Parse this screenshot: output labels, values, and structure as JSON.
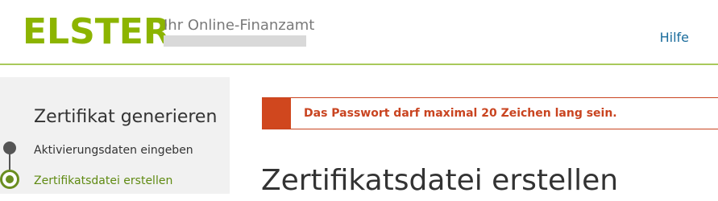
{
  "header": {
    "logo_text": "ELSTER",
    "tagline": "Ihr Online-Finanzamt",
    "help_label": "Hilfe"
  },
  "sidebar": {
    "title": "Zertifikat generieren",
    "steps": [
      {
        "label": "Aktivierungsdaten eingeben",
        "state": "completed"
      },
      {
        "label": "Zertifikatsdatei erstellen",
        "state": "current"
      }
    ]
  },
  "main": {
    "alert_message": "Das Passwort darf maximal 20 Zeichen lang sein.",
    "page_title": "Zertifikatsdatei erstellen"
  },
  "colors": {
    "brand_green": "#8cb400",
    "active_step_green": "#5f8a12",
    "error_red": "#c94420",
    "link_blue": "#1a6c9c"
  },
  "icons": {
    "completed_step": "filled-circle-icon",
    "current_step": "ring-circle-icon",
    "alert_marker": "error-marker-icon"
  }
}
